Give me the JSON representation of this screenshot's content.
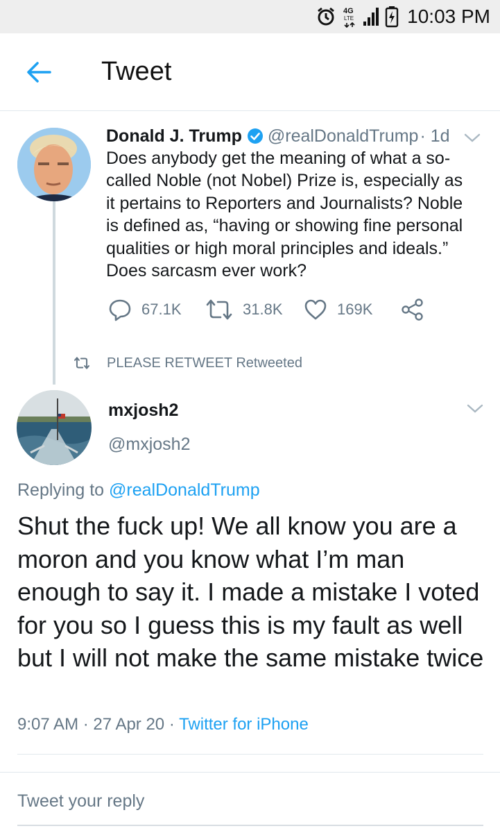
{
  "status_bar": {
    "time": "10:03 PM",
    "network": "4G LTE",
    "icons": [
      "alarm-icon",
      "network-4g-icon",
      "signal-icon",
      "battery-charging-icon"
    ]
  },
  "header": {
    "title": "Tweet",
    "back_icon": "arrow-left-icon"
  },
  "original_tweet": {
    "name": "Donald J. Trump",
    "handle": "@realDonaldTrump",
    "time": "· 1d",
    "text": "Does anybody get the meaning of what a so-called Noble (not Nobel) Prize is, especially as it pertains to Reporters and Journalists? Noble is defined as, “having or showing fine personal qualities or high moral principles and ideals.” Does sarcasm ever work?",
    "replies": "67.1K",
    "retweets": "31.8K",
    "likes": "169K",
    "retweet_note": "PLEASE RETWEET Retweeted"
  },
  "reply_tweet": {
    "name": "mxjosh2",
    "handle": "@mxjosh2",
    "replying_prefix": "Replying to ",
    "replying_to": "@realDonaldTrump",
    "text": "Shut the fuck up! We all know you are a moron and you know what I’m man enough to say it. I made a mistake I voted for you so I guess this is my fault as well but I will not make the same mistake twice",
    "time": "9:07 AM",
    "separator": "·",
    "date": "27 Apr 20",
    "source": "Twitter for iPhone"
  },
  "reply_box": {
    "placeholder": "Tweet your reply"
  },
  "colors": {
    "accent": "#1da1f2",
    "secondary_text": "#657786",
    "primary_text": "#14171a",
    "status_bar_bg": "#eeeeee"
  }
}
